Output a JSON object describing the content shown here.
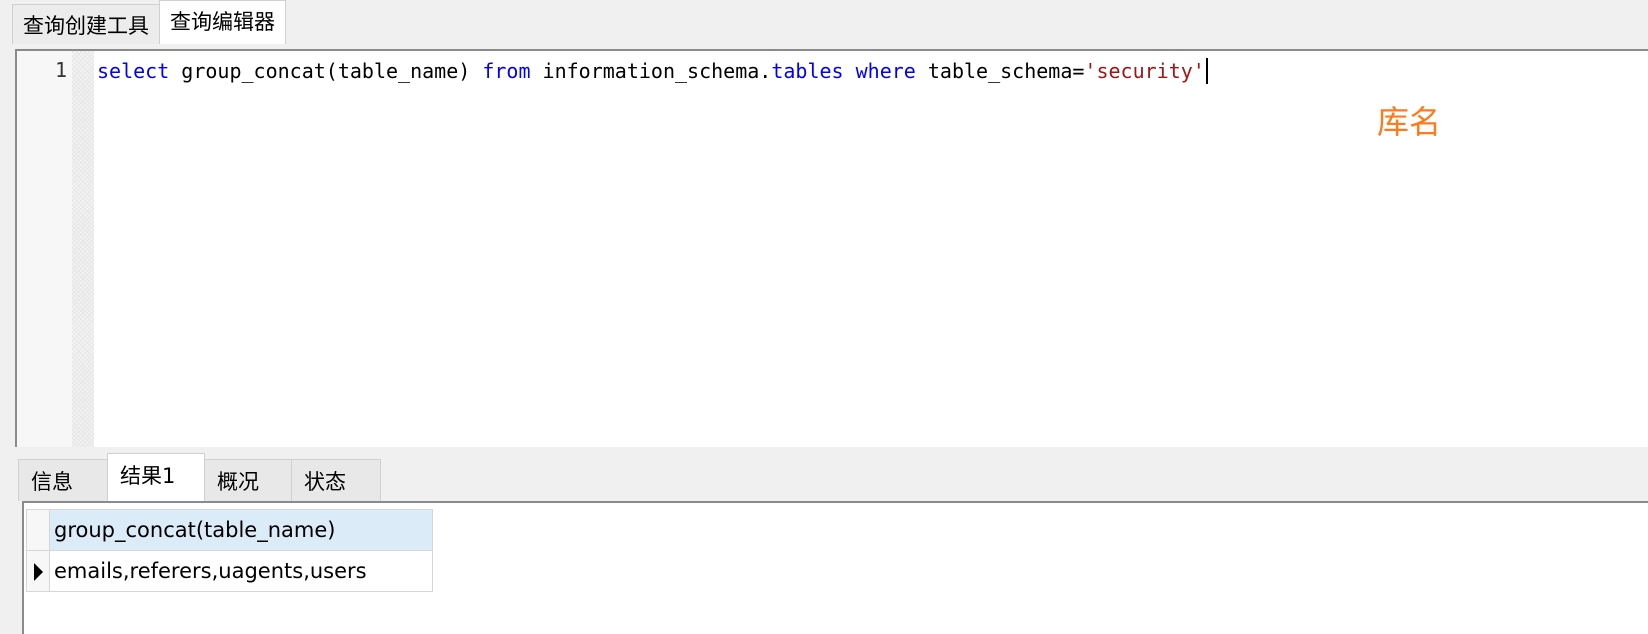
{
  "top_tabs": [
    {
      "label": "查询创建工具",
      "active": false
    },
    {
      "label": "查询编辑器",
      "active": true
    }
  ],
  "editor": {
    "line_number": "1",
    "tokens": {
      "select": "select",
      "t1": " group_concat(table_name) ",
      "from": "from",
      "t2": " information_schema.",
      "tables": "tables",
      "t3": " ",
      "where": "where",
      "t4": " table_schema=",
      "literal": "'security'"
    },
    "annotation": "库名",
    "colors": {
      "keyword": "#0000ff",
      "string": "#a31515",
      "annotation": "#ff7a1a"
    }
  },
  "bottom_tabs": [
    {
      "label": "信息",
      "active": false
    },
    {
      "label": "结果1",
      "active": true
    },
    {
      "label": "概况",
      "active": false
    },
    {
      "label": "状态",
      "active": false
    }
  ],
  "results": {
    "columns": [
      "group_concat(table_name)"
    ],
    "rows": [
      [
        "emails,referers,uagents,users"
      ]
    ],
    "header_color": "#dcebf8",
    "row_pointer_icon": "current-row-pointer-icon"
  }
}
